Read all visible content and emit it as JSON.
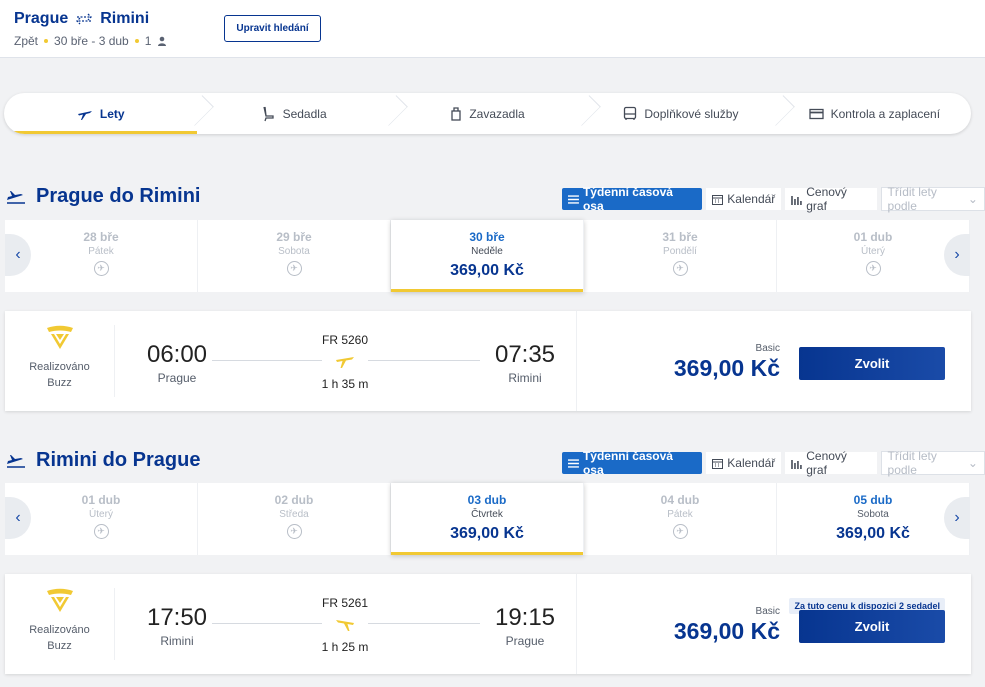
{
  "header": {
    "from": "Prague",
    "to": "Rimini",
    "trip_type": "Zpět",
    "dates": "30 bře - 3 dub",
    "passengers": "1",
    "edit_label": "Upravit hledání"
  },
  "steps": [
    {
      "label": "Lety",
      "icon": "plane-icon",
      "active": true
    },
    {
      "label": "Sedadla",
      "icon": "seat-icon"
    },
    {
      "label": "Zavazadla",
      "icon": "luggage-icon"
    },
    {
      "label": "Doplňkové služby",
      "icon": "bus-icon"
    },
    {
      "label": "Kontrola a zaplacení",
      "icon": "card-icon"
    }
  ],
  "view_tabs": {
    "weekly": "Týdenní časová osa",
    "calendar": "Kalendář",
    "price_graph": "Cenový graf",
    "sort": "Třídit lety podle"
  },
  "outbound": {
    "title": "Prague do Rimini",
    "days": [
      {
        "date": "28 bře",
        "weekday": "Pátek",
        "price": null
      },
      {
        "date": "29 bře",
        "weekday": "Sobota",
        "price": null
      },
      {
        "date": "30 bře",
        "weekday": "Neděle",
        "price": "369,00 Kč",
        "selected": true
      },
      {
        "date": "31 bře",
        "weekday": "Pondělí",
        "price": null
      },
      {
        "date": "01 dub",
        "weekday": "Úterý",
        "price": null
      }
    ],
    "flight": {
      "operator_label": "Realizováno",
      "operator_name": "Buzz",
      "dep_time": "06:00",
      "dep_city": "Prague",
      "arr_time": "07:35",
      "arr_city": "Rimini",
      "flight_no": "FR 5260",
      "duration": "1 h 35 m",
      "fare_name": "Basic",
      "price": "369,00 Kč",
      "select_label": "Zvolit"
    }
  },
  "inbound": {
    "title": "Rimini do Prague",
    "days": [
      {
        "date": "01 dub",
        "weekday": "Úterý",
        "price": null
      },
      {
        "date": "02 dub",
        "weekday": "Středa",
        "price": null
      },
      {
        "date": "03 dub",
        "weekday": "Čtvrtek",
        "price": "369,00 Kč",
        "selected": true
      },
      {
        "date": "04 dub",
        "weekday": "Pátek",
        "price": null
      },
      {
        "date": "05 dub",
        "weekday": "Sobota",
        "price": "369,00 Kč"
      }
    ],
    "flight": {
      "operator_label": "Realizováno",
      "operator_name": "Buzz",
      "dep_time": "17:50",
      "dep_city": "Rimini",
      "arr_time": "19:15",
      "arr_city": "Prague",
      "flight_no": "FR 5261",
      "duration": "1 h 25 m",
      "seat_message": "Za tuto cenu k dispozici 2 sedadel",
      "fare_name": "Basic",
      "price": "369,00 Kč",
      "select_label": "Zvolit"
    }
  },
  "colors": {
    "brand": "#073590",
    "accent": "#f1c933",
    "active_tab": "#1a6ac7"
  }
}
